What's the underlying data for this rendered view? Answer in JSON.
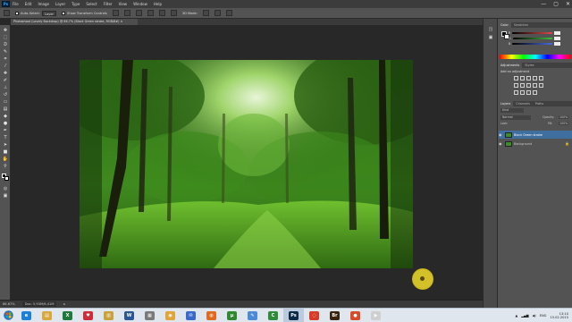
{
  "menubar": {
    "logo": "Ps",
    "items": [
      "File",
      "Edit",
      "Image",
      "Layer",
      "Type",
      "Select",
      "Filter",
      "View",
      "Window",
      "Help"
    ]
  },
  "window_controls": [
    "—",
    "▢",
    "✕"
  ],
  "options_bar": {
    "auto_select_label": "Auto-Select:",
    "auto_select_value": "Layer",
    "show_transform_label": "Show Transform Controls",
    "mode_label": "3D Mode:"
  },
  "document_tab": {
    "title": "Photoshoot (Lovely Backdrop) @ 66.7% (Black Green stroke, RGB/8#) ×"
  },
  "statusbar": {
    "zoom": "66.67%",
    "doc_size": "Doc: 5,93M/6,41M"
  },
  "panels": {
    "color_tabs": [
      "Color",
      "Swatches"
    ],
    "color_sliders": [
      {
        "label": "R",
        "value": 0,
        "color": "#e04a4a"
      },
      {
        "label": "G",
        "value": 0,
        "color": "#3fbf3f"
      },
      {
        "label": "B",
        "value": 0,
        "color": "#4a6ae0"
      }
    ],
    "adjustments_tabs": [
      "Adjustments",
      "Styles"
    ],
    "adjustments_hint": "Add an adjustment",
    "layers_tabs": [
      "Layers",
      "Channels",
      "Paths"
    ],
    "layers_kind": "Kind",
    "layers_blend": "Normal",
    "layers_opacity_label": "Opacity:",
    "layers_opacity": "100%",
    "layers_lock_label": "Lock:",
    "layers_fill_label": "Fill:",
    "layers_fill": "100%",
    "layers": [
      {
        "name": "Black Green stroke",
        "selected": true
      },
      {
        "name": "Background",
        "selected": false
      }
    ]
  },
  "taskbar": {
    "apps": [
      {
        "name": "internet-explorer",
        "letter": "e",
        "color": "#1e7fd6",
        "active": false
      },
      {
        "name": "file-explorer",
        "letter": "▤",
        "color": "#d9a83a",
        "active": false
      },
      {
        "name": "excel",
        "letter": "X",
        "color": "#1f7a3c",
        "active": false
      },
      {
        "name": "heart-app",
        "letter": "♥",
        "color": "#d12a3a",
        "active": false
      },
      {
        "name": "folder",
        "letter": "▥",
        "color": "#c9a23a",
        "active": false
      },
      {
        "name": "word",
        "letter": "W",
        "color": "#2b5797",
        "active": false
      },
      {
        "name": "media-app",
        "letter": "▦",
        "color": "#7a7a7a",
        "active": false
      },
      {
        "name": "chrome",
        "letter": "◉",
        "color": "#e0a43a",
        "active": false
      },
      {
        "name": "mail-app",
        "letter": "✉",
        "color": "#3a6ac9",
        "active": false
      },
      {
        "name": "firefox",
        "letter": "◍",
        "color": "#e06a1f",
        "active": false
      },
      {
        "name": "torrent-app",
        "letter": "μ",
        "color": "#2f8a2f",
        "active": false
      },
      {
        "name": "notes-app",
        "letter": "✎",
        "color": "#4a8ad8",
        "active": false
      },
      {
        "name": "camtasia",
        "letter": "C",
        "color": "#2f8a3a",
        "active": false
      },
      {
        "name": "photoshop",
        "letter": "Ps",
        "color": "#0c2a48",
        "active": true
      },
      {
        "name": "screen-recorder",
        "letter": "◌",
        "color": "#d83a2a",
        "active": false
      },
      {
        "name": "bridge",
        "letter": "Br",
        "color": "#3a2410",
        "active": false
      },
      {
        "name": "record-app",
        "letter": "●",
        "color": "#d84a2a",
        "active": false
      },
      {
        "name": "video-app",
        "letter": "▶",
        "color": "#cfcfcf",
        "active": false
      }
    ],
    "lang": "ENG",
    "time": "13:10",
    "date": "15.02.2015"
  }
}
